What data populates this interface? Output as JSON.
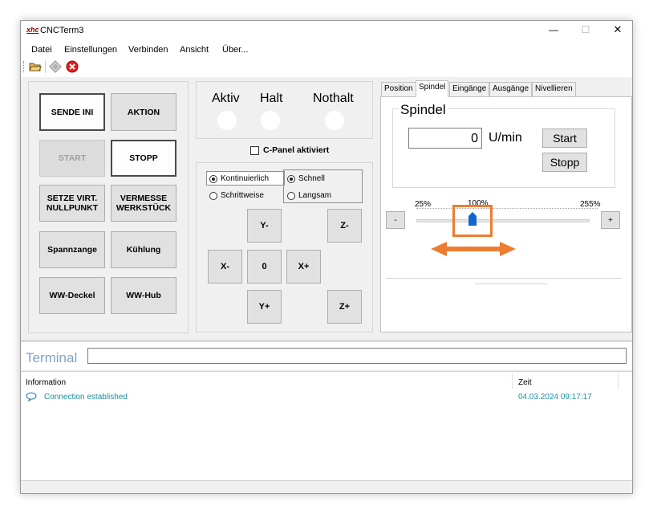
{
  "window": {
    "title": "CNCTerm3",
    "app_logo": "xhc",
    "controls": {
      "minimize": "—",
      "maximize": "☐",
      "close": "✕"
    }
  },
  "menu": [
    "Datei",
    "Einstellungen",
    "Verbinden",
    "Ansicht",
    "Über..."
  ],
  "toolbar": {
    "icons": [
      "open-folder-icon",
      "diamond-icon",
      "stop-icon"
    ]
  },
  "left_buttons": {
    "sende_ini": "SENDE INI",
    "aktion": "AKTION",
    "start": "START",
    "stopp": "STOPP",
    "setze_line1": "SETZE VIRT.",
    "setze_line2": "NULLPUNKT",
    "vermesse_line1": "VERMESSE",
    "vermesse_line2": "WERKSTÜCK",
    "spannzange": "Spannzange",
    "kuehlung": "Kühlung",
    "ww_deckel": "WW-Deckel",
    "ww_hub": "WW-Hub"
  },
  "status": {
    "aktiv": "Aktiv",
    "halt": "Halt",
    "nothalt": "Nothalt"
  },
  "cpanel": {
    "label": "C-Panel aktiviert",
    "checked": false
  },
  "jog": {
    "kontinuierlich": "Kontinuierlich",
    "schrittweise": "Schrittweise",
    "schnell": "Schnell",
    "langsam": "Langsam",
    "y_minus": "Y-",
    "z_minus": "Z-",
    "x_minus": "X-",
    "zero": "0",
    "x_plus": "X+",
    "y_plus": "Y+",
    "z_plus": "Z+"
  },
  "tabs": [
    "Position",
    "Spindel",
    "Eingänge",
    "Ausgänge",
    "Nivellieren"
  ],
  "active_tab": "Spindel",
  "spindel": {
    "title": "Spindel",
    "value": "0",
    "unit": "U/min",
    "start": "Start",
    "stopp": "Stopp",
    "minus": "-",
    "plus": "+",
    "tick_min": "25%",
    "tick_mid": "100%",
    "tick_max": "255%",
    "override_percent": 100,
    "highlight_color": "#ed7d31"
  },
  "terminal": {
    "label": "Terminal",
    "input_value": "",
    "columns": {
      "info": "Information",
      "time": "Zeit"
    },
    "rows": [
      {
        "info": "Connection established",
        "time": "04.03.2024 09:17:17",
        "icon": "chat-bubble-icon"
      }
    ],
    "text_color": "#1a8fa0"
  }
}
